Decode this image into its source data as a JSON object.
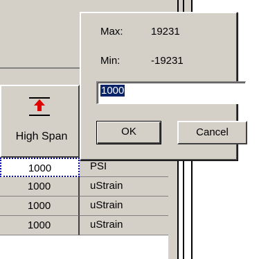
{
  "dialog": {
    "max_label": "Max:",
    "max_value": "19231",
    "min_label": "Min:",
    "min_value": "-19231",
    "input_value": "1000",
    "ok_label": "OK",
    "cancel_label": "Cancel"
  },
  "table": {
    "column_header": "High Span",
    "rows": [
      {
        "value": "1000",
        "unit": "PSI"
      },
      {
        "value": "1000",
        "unit": "uStrain"
      },
      {
        "value": "1000",
        "unit": "uStrain"
      },
      {
        "value": "1000",
        "unit": "uStrain"
      }
    ]
  },
  "icons": {
    "header_icon": "high-span-arrow-icon"
  },
  "colors": {
    "face": "#d4d0c8",
    "selection": "#0a246a",
    "arrow": "#e00000"
  }
}
